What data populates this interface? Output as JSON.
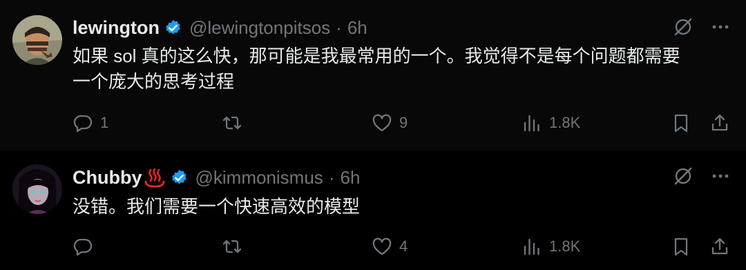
{
  "thread": {
    "tweets": [
      {
        "display_name": "lewington",
        "handle": "@lewingtonpitsos",
        "separator": "·",
        "time": "6h",
        "text_lines": [
          "如果 sol 真的这么快，那可能是我最常用的一个。我觉得不是每个问题都需要",
          "一个庞大的思考过程"
        ],
        "reply_count": "1",
        "repost_count": "",
        "like_count": "9",
        "view_count": "1.8K"
      },
      {
        "display_name": "Chubby",
        "name_emoji": "hot-springs-emoji",
        "handle": "@kimmonismus",
        "separator": "·",
        "time": "6h",
        "text_lines": [
          "没错。我们需要一个快速高效的模型"
        ],
        "reply_count": "",
        "repost_count": "",
        "like_count": "4",
        "view_count": "1.8K"
      }
    ]
  },
  "colors": {
    "background": "#000000",
    "text": "#e7e9ea",
    "muted": "#71767b",
    "verified": "#1d9bf0",
    "thread_line": "#333639",
    "emoji": "#f4212e"
  },
  "icons": [
    "verified-badge-icon",
    "grok-icon",
    "more-icon",
    "reply-icon",
    "repost-icon",
    "like-icon",
    "views-icon",
    "bookmark-icon",
    "share-icon"
  ]
}
